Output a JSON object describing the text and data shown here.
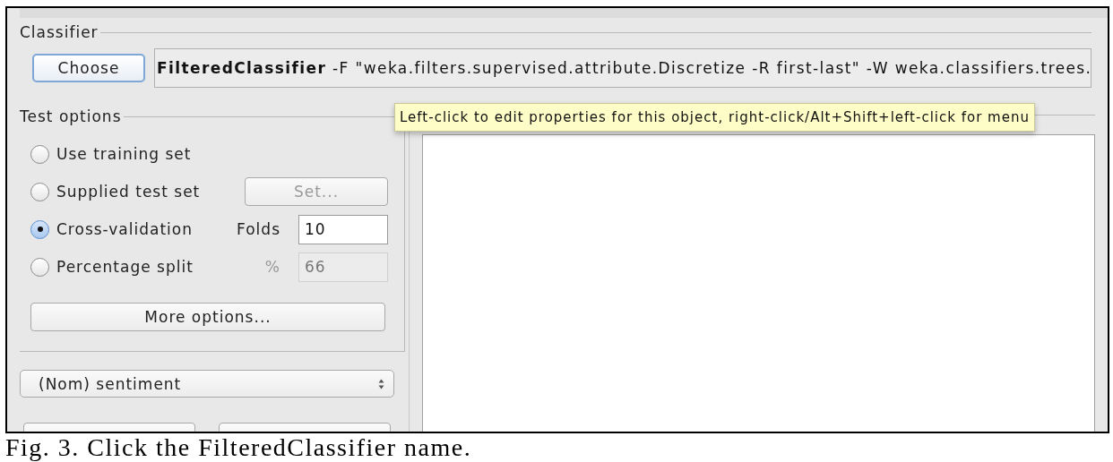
{
  "classifier": {
    "legend": "Classifier",
    "choose_button": "Choose",
    "command": "**FilteredClassifier** -F \"weka.filters.supervised.attribute.Discretize -R first-last\" -W weka.classifiers.trees."
  },
  "tooltip": "Left-click to edit properties for this object, right-click/Alt+Shift+left-click for menu",
  "test_options": {
    "legend": "Test options",
    "options": [
      {
        "label": "Use training set",
        "selected": false
      },
      {
        "label": "Supplied test set",
        "selected": false,
        "button": {
          "label": "Set...",
          "disabled": true
        }
      },
      {
        "label": "Cross-validation",
        "selected": true,
        "field": {
          "label": "Folds",
          "value": "10",
          "disabled": false
        }
      },
      {
        "label": "Percentage split",
        "selected": false,
        "field": {
          "label": "%",
          "value": "66",
          "disabled": true
        }
      }
    ],
    "more_button": "More options..."
  },
  "class_dropdown": {
    "value": "(Nom) sentiment"
  },
  "caption": "Fig. 3. Click the FilteredClassifier name."
}
